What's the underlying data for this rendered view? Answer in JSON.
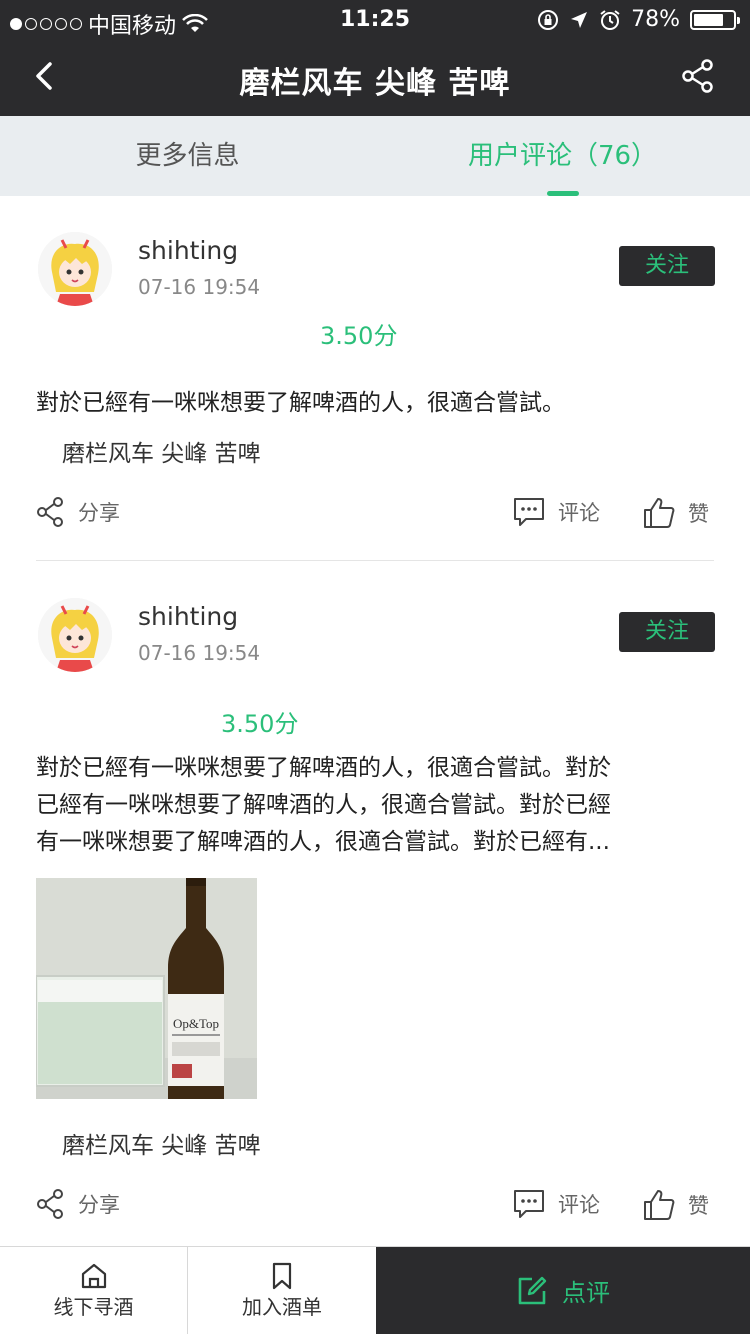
{
  "status_bar": {
    "carrier": "中国移动",
    "time": "11:25",
    "battery": "78%",
    "battery_level": 0.78
  },
  "nav": {
    "title": "磨栏风车  尖峰 苦啤"
  },
  "tabs": [
    {
      "label": "更多信息",
      "active": false
    },
    {
      "label": "用户评论（76）",
      "active": true
    }
  ],
  "reviews": [
    {
      "username": "shihting",
      "date": "07-16 19:54",
      "follow_label": "关注",
      "score": "3.50分",
      "text": "對於已經有一咪咪想要了解啤酒的人，很適合嘗試。",
      "tag": "磨栏风车 尖峰 苦啤",
      "share_label": "分享",
      "comment_label": "评论",
      "like_label": "赞"
    },
    {
      "username": "shihting",
      "date": "07-16 19:54",
      "follow_label": "关注",
      "score": "3.50分",
      "text_lines": [
        "對於已經有一咪咪想要了解啤酒的人，很適合嘗試。對於",
        "已經有一咪咪想要了解啤酒的人，很適合嘗試。對於已經",
        "有一咪咪想要了解啤酒的人，很適合嘗試。對於已經有..."
      ],
      "photo_label": "Op&Top",
      "tag": "磨栏风车 尖峰 苦啤",
      "share_label": "分享",
      "comment_label": "评论",
      "like_label": "赞"
    }
  ],
  "bottom_bar": {
    "find_offline": "线下寻酒",
    "add_to_list": "加入酒单",
    "write_review": "点评"
  },
  "colors": {
    "accent": "#2bbf7a",
    "dark": "#2b2b2d",
    "tab_bg": "#e9edf0"
  }
}
